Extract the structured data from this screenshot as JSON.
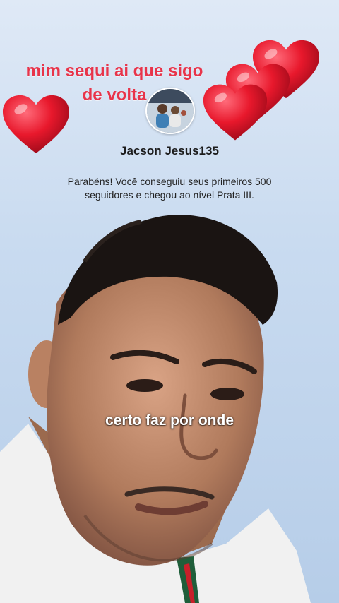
{
  "story": {
    "caption_line1": "mim sequi ai que sigo",
    "caption_line2": "de volta",
    "overlay_text": "certo faz por onde"
  },
  "badge": {
    "username": "Jacson Jesus135",
    "message_line1": "Parabéns! Você conseguiu seus primeiros 500",
    "message_line2": "seguidores e chegou ao nível Prata III."
  },
  "colors": {
    "caption": "#e8344a",
    "heart": "#e8182c",
    "background": "#c9dbf0"
  },
  "icons": {
    "hearts": "heart-icon",
    "avatar": "profile-avatar"
  }
}
